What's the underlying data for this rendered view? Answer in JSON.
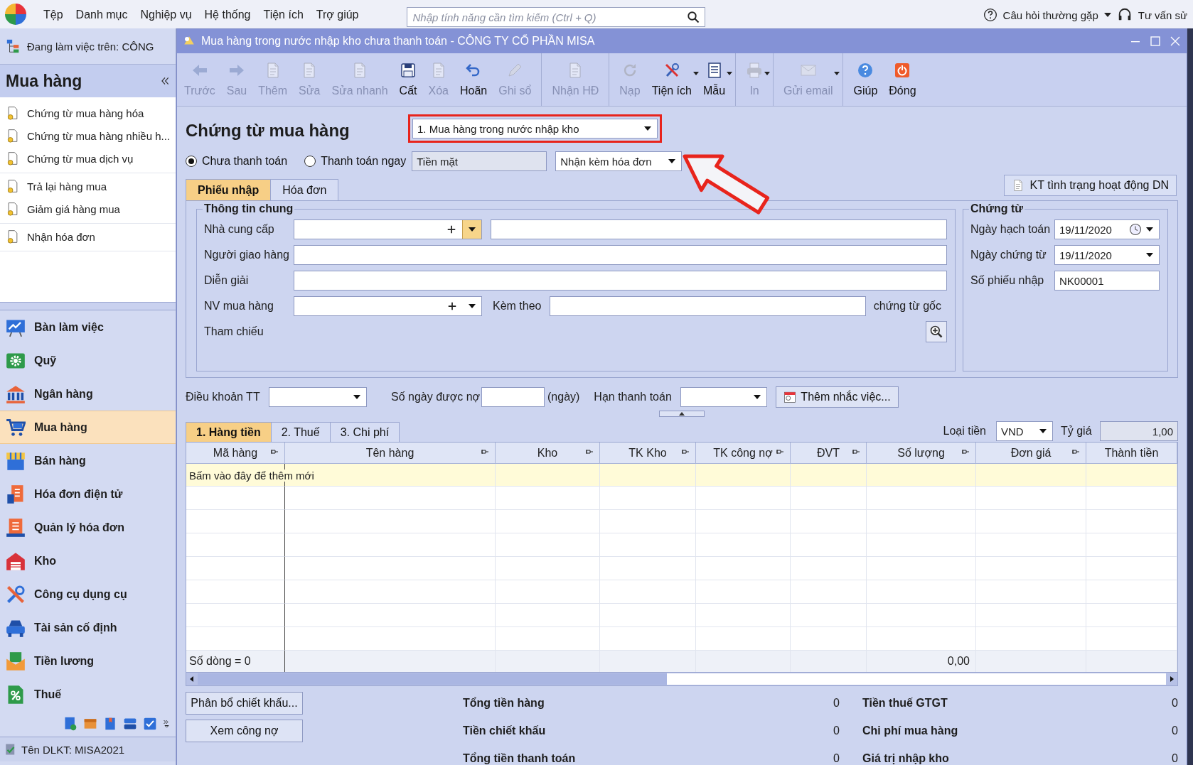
{
  "app_menu": {
    "items": [
      "Tệp",
      "Danh mục",
      "Nghiệp vụ",
      "Hệ thống",
      "Tiện ích",
      "Trợ giúp"
    ],
    "search": {
      "placeholder": "Nhập tính năng cần tìm kiếm (Ctrl + Q)"
    },
    "faq": "Câu hỏi thường gặp",
    "advisor": "Tư vấn sử"
  },
  "sidebar": {
    "workspace": "Đang làm việc trên: CÔNG",
    "title": "Mua hàng",
    "action_groups": [
      [
        "Chứng từ mua hàng hóa",
        "Chứng từ mua hàng nhiều h...",
        "Chứng từ mua dịch vụ"
      ],
      [
        "Trả lại hàng mua",
        "Giảm giá hàng mua"
      ],
      [
        "Nhận hóa đơn"
      ]
    ],
    "modules": [
      {
        "label": "Bàn làm việc",
        "selected": false
      },
      {
        "label": "Quỹ",
        "selected": false
      },
      {
        "label": "Ngân hàng",
        "selected": false
      },
      {
        "label": "Mua hàng",
        "selected": true
      },
      {
        "label": "Bán hàng",
        "selected": false
      },
      {
        "label": "Hóa đơn điện tử",
        "selected": false
      },
      {
        "label": "Quản lý hóa đơn",
        "selected": false
      },
      {
        "label": "Kho",
        "selected": false
      },
      {
        "label": "Công cụ dụng cụ",
        "selected": false
      },
      {
        "label": "Tài sản cố định",
        "selected": false
      },
      {
        "label": "Tiền lương",
        "selected": false
      },
      {
        "label": "Thuế",
        "selected": false
      }
    ],
    "status": "Tên DLKT: MISA2021"
  },
  "window": {
    "title": "Mua hàng trong nước nhập kho chưa thanh toán - CÔNG TY CỔ PHẦN MISA",
    "toolbar": [
      [
        {
          "label": "Trước",
          "disabled": true,
          "dropdown": false
        },
        {
          "label": "Sau",
          "disabled": true,
          "dropdown": false
        },
        {
          "label": "Thêm",
          "disabled": true,
          "dropdown": false
        },
        {
          "label": "Sửa",
          "disabled": true,
          "dropdown": false
        },
        {
          "label": "Sửa nhanh",
          "disabled": true,
          "dropdown": false
        },
        {
          "label": "Cất",
          "disabled": false,
          "dropdown": false
        },
        {
          "label": "Xóa",
          "disabled": true,
          "dropdown": false
        },
        {
          "label": "Hoãn",
          "disabled": false,
          "dropdown": false
        },
        {
          "label": "Ghi sổ",
          "disabled": true,
          "dropdown": false
        }
      ],
      [
        {
          "label": "Nhận HĐ",
          "disabled": true,
          "dropdown": false
        }
      ],
      [
        {
          "label": "Nạp",
          "disabled": true,
          "dropdown": false
        },
        {
          "label": "Tiện ích",
          "disabled": false,
          "dropdown": true
        },
        {
          "label": "Mẫu",
          "disabled": false,
          "dropdown": true
        }
      ],
      [
        {
          "label": "In",
          "disabled": true,
          "dropdown": true
        }
      ],
      [
        {
          "label": "Gửi email",
          "disabled": true,
          "dropdown": true
        }
      ],
      [
        {
          "label": "Giúp",
          "disabled": false,
          "dropdown": false
        },
        {
          "label": "Đóng",
          "disabled": false,
          "dropdown": false
        }
      ]
    ]
  },
  "form": {
    "heading": "Chứng từ mua hàng",
    "voucher_type": {
      "value": "1. Mua hàng trong nước nhập kho",
      "highlighted": true
    },
    "payment_options": [
      {
        "label": "Chưa thanh toán",
        "selected": true
      },
      {
        "label": "Thanh toán ngay",
        "selected": false
      }
    ],
    "payment_method": {
      "value": "Tiền mặt",
      "disabled": true
    },
    "invoice_option": {
      "value": "Nhận kèm hóa đơn"
    },
    "callouts": [
      {
        "kind": "arrow"
      }
    ],
    "tabs": [
      {
        "label": "Phiếu nhập",
        "selected": true
      },
      {
        "label": "Hóa đơn",
        "selected": false
      }
    ],
    "check_button": "KT tình trạng hoạt động DN",
    "general": {
      "title": "Thông tin chung",
      "supplier": "Nhà cung cấp",
      "deliverer": "Người giao hàng",
      "description": "Diễn giải",
      "buyer": "NV mua hàng",
      "attached": "Kèm theo",
      "attached_suffix": "chứng từ gốc",
      "reference": "Tham chiếu"
    },
    "voucher": {
      "title": "Chứng từ",
      "fields": [
        {
          "label": "Ngày hạch toán",
          "value": "19/11/2020",
          "kind": "clock-date"
        },
        {
          "label": "Ngày chứng từ",
          "value": "19/11/2020",
          "kind": "date"
        },
        {
          "label": "Số phiếu nhập",
          "value": "NK00001",
          "kind": "text"
        }
      ]
    },
    "terms": {
      "label": "Điều khoản TT",
      "days_label": "Số ngày được nợ",
      "days_unit": "(ngày)",
      "due_label": "Hạn thanh toán",
      "reminder_button": "Thêm nhắc việc..."
    },
    "detail_tabs": [
      {
        "label": "1. Hàng tiền",
        "selected": true
      },
      {
        "label": "2. Thuế",
        "selected": false
      },
      {
        "label": "3. Chi phí",
        "selected": false
      }
    ],
    "currency": {
      "label": "Loại tiền",
      "value": "VND",
      "rate_label": "Tỷ giá",
      "rate": "1,00"
    },
    "table": {
      "columns": [
        "Mã hàng",
        "Tên hàng",
        "Kho",
        "TK Kho",
        "TK công nợ",
        "ĐVT",
        "Số lượng",
        "Đơn giá",
        "Thành tiền"
      ],
      "new_row_hint": "Bấm vào đây để thêm mới",
      "row_count": "Số dòng = 0",
      "quantity_total": "0,00"
    },
    "buttons": [
      "Phân bổ chiết khấu...",
      "Xem công nợ"
    ],
    "totals": [
      {
        "label": "Tổng tiền hàng",
        "value": "0"
      },
      {
        "label": "Tiền thuế GTGT",
        "value": "0"
      },
      {
        "label": "Tiền chiết khấu",
        "value": "0"
      },
      {
        "label": "Chi phí mua hàng",
        "value": "0"
      },
      {
        "label": "Tổng tiền thanh toán",
        "value": "0"
      },
      {
        "label": "Giá trị nhập kho",
        "value": "0"
      }
    ]
  }
}
